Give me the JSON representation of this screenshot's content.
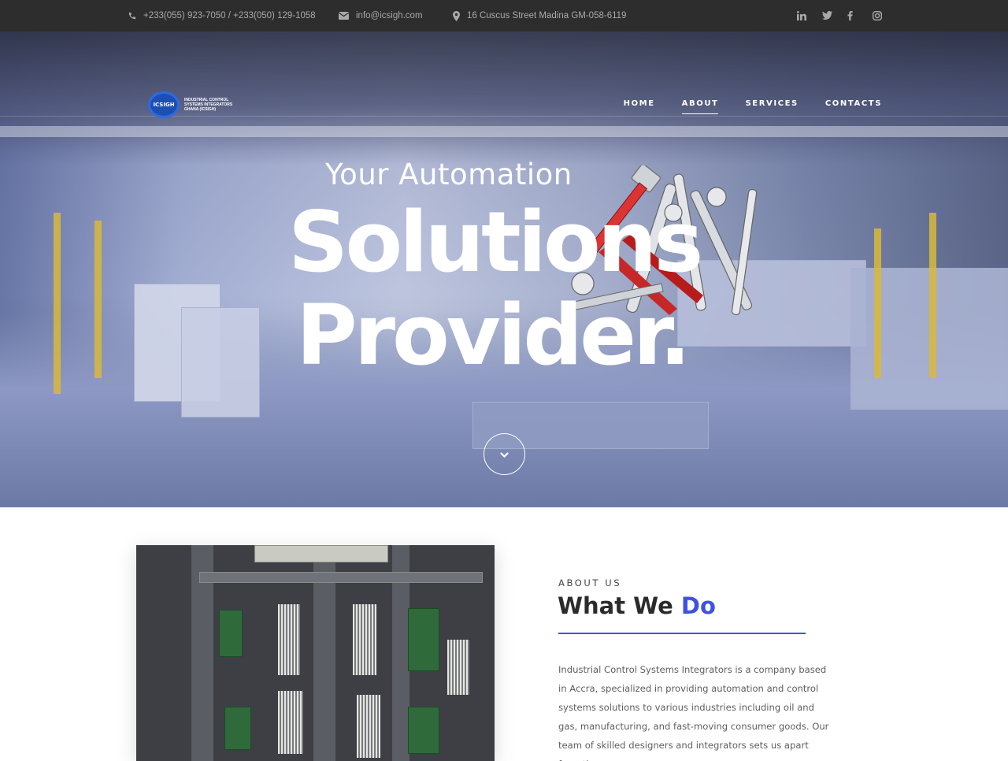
{
  "topbar": {
    "phone": "+233(055) 923-7050 / +233(050) 129-1058",
    "email": "info@icsigh.com",
    "address": "16 Cuscus Street Madina GM-058-6119",
    "social": [
      "linkedin-icon",
      "twitter-icon",
      "facebook-icon",
      "instagram-icon"
    ]
  },
  "logo": {
    "badge": "ICSIGH",
    "text": "INDUSTRIAL CONTROL SYSTEMS INTEGRATORS GHANA (ICSIGH)"
  },
  "nav": [
    {
      "label": "HOME",
      "active": false
    },
    {
      "label": "ABOUT",
      "active": true
    },
    {
      "label": "SERVICES",
      "active": false
    },
    {
      "label": "CONTACTS",
      "active": false
    }
  ],
  "hero": {
    "subtitle": "Your Automation",
    "line1": "Solutions",
    "line2": "Provider."
  },
  "about": {
    "kicker": "ABOUT US",
    "title_main": "What We",
    "title_accent": "Do",
    "body": "Industrial Control Systems Integrators is a company based in Accra, specialized in providing automation and control systems solutions to various industries including oil and gas, manufacturing, and fast-moving consumer goods. Our team of skilled designers and integrators sets us apart from the"
  },
  "colors": {
    "accent": "#4052dc",
    "topbar_bg": "#2d2d2d",
    "topbar_text": "#a9a9a9"
  }
}
